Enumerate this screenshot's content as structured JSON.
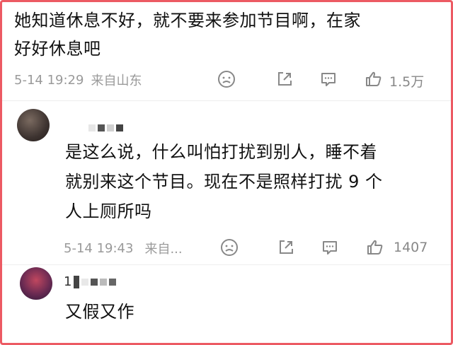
{
  "comments": [
    {
      "lines": [
        "她知道休息不好，就不要来参加节目啊，在家",
        "好好休息吧"
      ],
      "time": "5-14 19:29",
      "location": "来自山东",
      "likes": "1.5万"
    },
    {
      "user_prefix": "",
      "lines": [
        "是这么说，什么叫怕打扰到别人，睡不着",
        "就别来这个节目。现在不是照样打扰 9 个",
        "人上厕所吗"
      ],
      "time": "5-14 19:43",
      "location": "来自...",
      "likes": "1407"
    },
    {
      "user_prefix": "1",
      "lines": [
        "又假又作"
      ]
    }
  ],
  "colors": {
    "border": "#ec5a63",
    "meta": "#9a9a9a",
    "text": "#111111"
  },
  "icons": [
    "sad-face-icon",
    "share-icon",
    "comment-icon",
    "thumbs-up-icon"
  ]
}
